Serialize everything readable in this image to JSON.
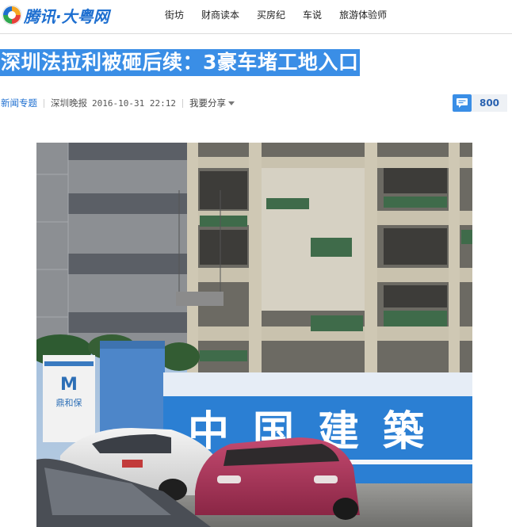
{
  "site": {
    "logo_text": "腾讯·大粤网",
    "logo_icon": "tencent-logo-icon"
  },
  "nav": {
    "items": [
      "街坊",
      "财商读本",
      "买房纪",
      "车说",
      "旅游体验师"
    ]
  },
  "article": {
    "title": "深圳法拉利被砸后续：3豪车堵工地入口",
    "category": "新闻专题",
    "source": "深圳晚报",
    "datetime": "2016-10-31 22:12",
    "share_label": "我要分享",
    "comment_count": "800"
  },
  "photo": {
    "hoarding_text": "中国建築",
    "sign_text": "鼎和保"
  },
  "colors": {
    "accent": "#3a8ee6",
    "link": "#1e6fd0",
    "hoarding_blue": "#2b7fd3"
  }
}
